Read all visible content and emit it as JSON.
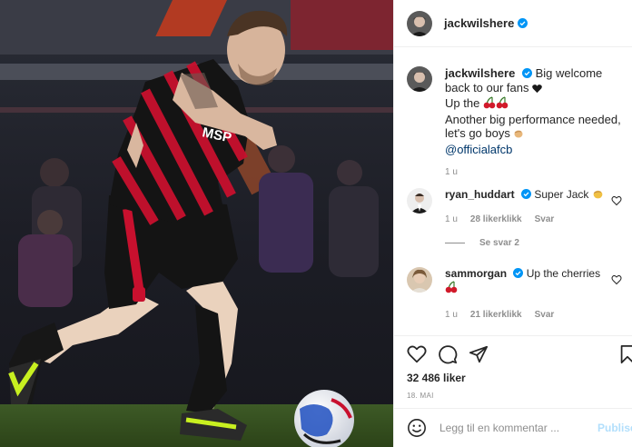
{
  "post": {
    "username": "jackwilshere",
    "caption": {
      "username": "jackwilshere",
      "line1": "Big welcome back to our fans",
      "line2": "Up the",
      "line3": "Another big performance needed, let's go boys",
      "mention": "@officialafcb",
      "time": "1 u"
    },
    "comments": [
      {
        "username": "ryan_huddart",
        "text": "Super Jack",
        "time": "1 u",
        "likes": "28 likerklikk",
        "reply": "Svar"
      },
      {
        "username": "sammorgan",
        "text": "Up the cherries",
        "time": "1 u",
        "likes": "21 likerklikk",
        "reply": "Svar"
      }
    ],
    "view_replies": "Se svar 2",
    "likes": "32 486 liker",
    "date": "18. MAI",
    "add_comment_placeholder": "Legg til en kommentar ...",
    "post_button": "Publiser"
  },
  "photo": {
    "shirt_sponsor": "MSP",
    "shirt_colors": {
      "red": "#c8102e",
      "black": "#141414"
    }
  },
  "colors": {
    "verified": "#0095f6",
    "link": "#00376b",
    "muted": "#8e8e8e",
    "post_disabled": "#b2dffc"
  },
  "icons": [
    "heart-icon",
    "comment-icon",
    "share-icon",
    "bookmark-icon",
    "smiley-icon",
    "verified-icon",
    "cherry-emoji",
    "clap-emoji",
    "black-heart-emoji"
  ]
}
